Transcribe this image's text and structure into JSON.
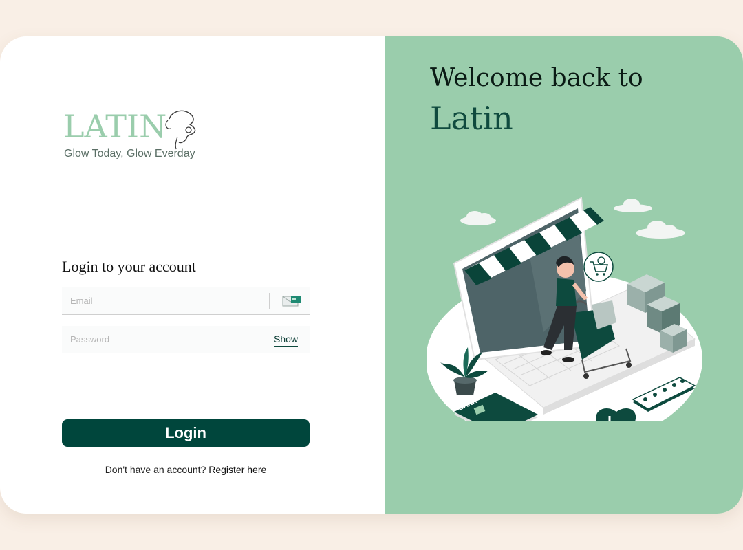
{
  "logo": {
    "word": "LATIN",
    "tagline": "Glow Today, Glow Everday",
    "icon": "face-line-icon"
  },
  "form": {
    "title": "Login to your account",
    "email_placeholder": "Email",
    "email_icon": "email-card-icon",
    "password_placeholder": "Password",
    "show_label": "Show",
    "login_label": "Login",
    "register_prompt": "Don't have an account?",
    "register_link": "Register here"
  },
  "hero": {
    "welcome": "Welcome back to",
    "brand": "Latin",
    "illustration": "online-shopping-illustration"
  },
  "colors": {
    "page_bg": "#f9efe6",
    "panel_green": "#9acdac",
    "primary_dark": "#00463c",
    "accent": "#0f4a3e"
  }
}
